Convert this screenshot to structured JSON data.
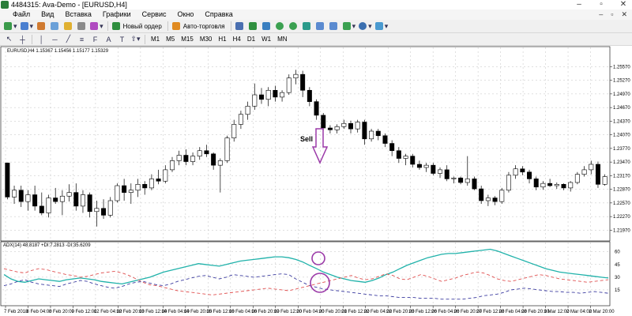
{
  "window": {
    "title": "4484315: Ava-Demo - [EURUSD,H4]",
    "controls": [
      "–",
      "▫",
      "✕"
    ]
  },
  "menu": {
    "items": [
      "Файл",
      "Вид",
      "Вставка",
      "Графики",
      "Сервис",
      "Окно",
      "Справка"
    ],
    "right_controls": [
      "–",
      "▫",
      "✕"
    ]
  },
  "toolbar1": {
    "new_order_label": "Новый ордер",
    "autotrading_label": "Авто-торговля"
  },
  "toolbar2": {
    "timeframes": [
      "M1",
      "M5",
      "M15",
      "M30",
      "H1",
      "H4",
      "D1",
      "W1",
      "MN"
    ]
  },
  "colors": {
    "bull_fill": "#ffffff",
    "bear_fill": "#000000",
    "candle_stroke": "#000000",
    "grid": "#c0c0c0",
    "adx": "#20b2aa",
    "plus_di": "#3c3ca0",
    "minus_di": "#e05050",
    "annotation": "#9b3aa8"
  },
  "chart_data": [
    {
      "type": "candlestick",
      "title": "EURUSD,H4 1.15367 1.15456 1.15177 1.15329",
      "y_ticks": [
        "1.25570",
        "1.24970",
        "1.24370",
        "1.23770",
        "1.23170",
        "1.22570",
        "1.21970",
        "1.25270",
        "1.24670",
        "1.24070",
        "1.23470",
        "1.22870",
        "1.22270"
      ],
      "ylim": [
        1.2182,
        1.2582
      ],
      "x_ticks": [
        "7 Feb 2018",
        "8 Feb 04:00",
        "8 Feb 20:00",
        "9 Feb 12:00",
        "12 Feb 04:00",
        "12 Feb 20:00",
        "13 Feb 12:00",
        "14 Feb 04:00",
        "14 Feb 20:00",
        "15 Feb 12:00",
        "16 Feb 04:00",
        "16 Feb 20:00",
        "19 Feb 12:00",
        "20 Feb 04:00",
        "20 Feb 20:00",
        "21 Feb 12:00",
        "22 Feb 04:00",
        "22 Feb 20:00",
        "23 Feb 12:00",
        "26 Feb 04:00",
        "26 Feb 20:00",
        "27 Feb 12:00",
        "28 Feb 04:00",
        "28 Feb 20:00",
        "1 Mar 12:00",
        "2 Mar 04:00",
        "2 Mar 20:00"
      ],
      "candles": [
        [
          1.2345,
          1.2345,
          1.2265,
          1.227
        ],
        [
          1.227,
          1.2295,
          1.2255,
          1.2285
        ],
        [
          1.2285,
          1.2295,
          1.2248,
          1.226
        ],
        [
          1.226,
          1.2285,
          1.224,
          1.2275
        ],
        [
          1.2275,
          1.2295,
          1.224,
          1.225
        ],
        [
          1.225,
          1.228,
          1.223,
          1.2235
        ],
        [
          1.2235,
          1.2275,
          1.2225,
          1.2268
        ],
        [
          1.2268,
          1.229,
          1.2255,
          1.226
        ],
        [
          1.226,
          1.2285,
          1.223,
          1.2272
        ],
        [
          1.2272,
          1.2298,
          1.226,
          1.228
        ],
        [
          1.228,
          1.23,
          1.224,
          1.225
        ],
        [
          1.225,
          1.2285,
          1.2235,
          1.2275
        ],
        [
          1.2275,
          1.228,
          1.2225,
          1.2238
        ],
        [
          1.2238,
          1.2262,
          1.2205,
          1.2245
        ],
        [
          1.2245,
          1.2265,
          1.2222,
          1.223
        ],
        [
          1.223,
          1.227,
          1.2225,
          1.2262
        ],
        [
          1.2262,
          1.23,
          1.2258,
          1.2295
        ],
        [
          1.2295,
          1.231,
          1.2262,
          1.228
        ],
        [
          1.228,
          1.23,
          1.2255,
          1.2285
        ],
        [
          1.2285,
          1.231,
          1.227,
          1.2298
        ],
        [
          1.2298,
          1.2305,
          1.2275,
          1.229
        ],
        [
          1.229,
          1.232,
          1.2285,
          1.231
        ],
        [
          1.231,
          1.233,
          1.2298,
          1.2305
        ],
        [
          1.2305,
          1.234,
          1.23,
          1.233
        ],
        [
          1.233,
          1.2358,
          1.2325,
          1.235
        ],
        [
          1.235,
          1.2372,
          1.234,
          1.2362
        ],
        [
          1.2362,
          1.2375,
          1.234,
          1.2348
        ],
        [
          1.2348,
          1.2368,
          1.234,
          1.236
        ],
        [
          1.236,
          1.238,
          1.2352,
          1.2372
        ],
        [
          1.2372,
          1.2385,
          1.2358,
          1.2365
        ],
        [
          1.2365,
          1.2368,
          1.233,
          1.234
        ],
        [
          1.234,
          1.2355,
          1.228,
          1.235
        ],
        [
          1.235,
          1.2405,
          1.2345,
          1.24
        ],
        [
          1.24,
          1.244,
          1.2392,
          1.243
        ],
        [
          1.243,
          1.246,
          1.242,
          1.2452
        ],
        [
          1.2452,
          1.248,
          1.244,
          1.247
        ],
        [
          1.247,
          1.252,
          1.2462,
          1.2495
        ],
        [
          1.2495,
          1.251,
          1.2475,
          1.2485
        ],
        [
          1.2485,
          1.2512,
          1.247,
          1.2505
        ],
        [
          1.2505,
          1.2515,
          1.248,
          1.249
        ],
        [
          1.249,
          1.2505,
          1.248,
          1.25
        ],
        [
          1.25,
          1.254,
          1.2495,
          1.2532
        ],
        [
          1.2532,
          1.255,
          1.2518,
          1.254
        ],
        [
          1.254,
          1.2548,
          1.249,
          1.2505
        ],
        [
          1.2505,
          1.2512,
          1.247,
          1.248
        ],
        [
          1.248,
          1.2485,
          1.244,
          1.245
        ],
        [
          1.245,
          1.2455,
          1.2415,
          1.2422
        ],
        [
          1.2422,
          1.2428,
          1.241,
          1.2418
        ],
        [
          1.2418,
          1.243,
          1.241,
          1.2425
        ],
        [
          1.2425,
          1.244,
          1.242,
          1.2432
        ],
        [
          1.2432,
          1.2438,
          1.241,
          1.242
        ],
        [
          1.242,
          1.244,
          1.2412,
          1.2435
        ],
        [
          1.2435,
          1.244,
          1.2385,
          1.2398
        ],
        [
          1.2398,
          1.242,
          1.2392,
          1.2415
        ],
        [
          1.2415,
          1.242,
          1.2395,
          1.2405
        ],
        [
          1.2405,
          1.241,
          1.238,
          1.2388
        ],
        [
          1.2388,
          1.2395,
          1.236,
          1.2372
        ],
        [
          1.2372,
          1.238,
          1.2345,
          1.2355
        ],
        [
          1.2355,
          1.2365,
          1.234,
          1.236
        ],
        [
          1.236,
          1.2365,
          1.2335,
          1.2342
        ],
        [
          1.2342,
          1.235,
          1.233,
          1.2335
        ],
        [
          1.2335,
          1.2345,
          1.2325,
          1.234
        ],
        [
          1.234,
          1.2345,
          1.2318,
          1.2322
        ],
        [
          1.2322,
          1.2335,
          1.2312,
          1.233
        ],
        [
          1.233,
          1.234,
          1.2305,
          1.231
        ],
        [
          1.231,
          1.2315,
          1.23,
          1.2312
        ],
        [
          1.2312,
          1.2315,
          1.2298,
          1.2302
        ],
        [
          1.2302,
          1.236,
          1.2295,
          1.231
        ],
        [
          1.231,
          1.2315,
          1.2285,
          1.2288
        ],
        [
          1.2288,
          1.2295,
          1.2255,
          1.2262
        ],
        [
          1.2262,
          1.2275,
          1.225,
          1.2268
        ],
        [
          1.2268,
          1.2272,
          1.2252,
          1.226
        ],
        [
          1.226,
          1.229,
          1.2255,
          1.2285
        ],
        [
          1.2285,
          1.2325,
          1.228,
          1.2318
        ],
        [
          1.2318,
          1.234,
          1.231,
          1.2332
        ],
        [
          1.2332,
          1.2338,
          1.2318,
          1.2325
        ],
        [
          1.2325,
          1.233,
          1.23,
          1.231
        ],
        [
          1.231,
          1.2315,
          1.2285,
          1.2292
        ],
        [
          1.2292,
          1.2305,
          1.2286,
          1.23
        ],
        [
          1.23,
          1.231,
          1.2292,
          1.2295
        ],
        [
          1.2295,
          1.2302,
          1.2288,
          1.2298
        ],
        [
          1.2298,
          1.23,
          1.2285,
          1.229
        ],
        [
          1.229,
          1.2305,
          1.2282,
          1.2302
        ],
        [
          1.2302,
          1.2325,
          1.2298,
          1.232
        ],
        [
          1.232,
          1.2338,
          1.2315,
          1.233
        ],
        [
          1.233,
          1.235,
          1.232,
          1.2342
        ],
        [
          1.2342,
          1.2348,
          1.229,
          1.2298
        ],
        [
          1.2298,
          1.232,
          1.2295,
          1.2315
        ]
      ]
    },
    {
      "type": "line",
      "title": "ADX(14) 48.8187 +DI:7.2813 -DI:35.6209",
      "y_ticks": [
        "60",
        "45",
        "30",
        "15",
        "0"
      ],
      "ylim": [
        0,
        70
      ],
      "series": [
        {
          "name": "ADX",
          "values": [
            33,
            28,
            25,
            24,
            26,
            28,
            27,
            26,
            25,
            27,
            28,
            29,
            28,
            27,
            25,
            24,
            23,
            22,
            24,
            26,
            28,
            30,
            33,
            36,
            38,
            40,
            42,
            44,
            46,
            45,
            44,
            43,
            45,
            47,
            49,
            50,
            51,
            52,
            53,
            54,
            54,
            53,
            51,
            48,
            44,
            40,
            36,
            33,
            30,
            28,
            26,
            25,
            24,
            26,
            29,
            33,
            36,
            40,
            44,
            47,
            50,
            53,
            55,
            57,
            58,
            58,
            59,
            60,
            61,
            62,
            63,
            61,
            58,
            55,
            52,
            49,
            46,
            43,
            40,
            38,
            36,
            35,
            34,
            33,
            32,
            31,
            30,
            29
          ]
        },
        {
          "name": "+DI",
          "values": [
            20,
            22,
            25,
            27,
            24,
            22,
            21,
            20,
            19,
            22,
            24,
            26,
            25,
            22,
            20,
            18,
            17,
            19,
            22,
            24,
            25,
            23,
            21,
            20,
            22,
            25,
            27,
            29,
            31,
            32,
            30,
            28,
            30,
            33,
            32,
            31,
            30,
            31,
            32,
            33,
            34,
            33,
            28,
            24,
            20,
            18,
            16,
            15,
            14,
            13,
            12,
            11,
            10,
            9,
            8,
            8,
            7,
            6,
            6,
            6,
            5,
            5,
            5,
            4,
            4,
            4,
            4,
            5,
            6,
            8,
            9,
            10,
            12,
            15,
            16,
            17,
            16,
            15,
            14,
            13,
            13,
            12,
            12,
            11,
            12,
            13,
            12,
            11
          ]
        },
        {
          "name": "-DI",
          "values": [
            40,
            38,
            36,
            35,
            38,
            40,
            39,
            37,
            35,
            33,
            32,
            30,
            31,
            33,
            35,
            36,
            37,
            35,
            32,
            28,
            24,
            21,
            20,
            18,
            16,
            14,
            13,
            12,
            11,
            10,
            9,
            10,
            11,
            12,
            13,
            14,
            15,
            16,
            17,
            16,
            15,
            14,
            16,
            18,
            20,
            22,
            24,
            26,
            28,
            30,
            32,
            29,
            27,
            28,
            31,
            34,
            32,
            28,
            27,
            30,
            33,
            31,
            28,
            25,
            27,
            29,
            32,
            34,
            36,
            35,
            32,
            28,
            26,
            25,
            27,
            29,
            31,
            33,
            32,
            30,
            28,
            27,
            26,
            25,
            24,
            25,
            26,
            27
          ]
        }
      ]
    }
  ],
  "annotations": {
    "signal_label": "Sell"
  }
}
